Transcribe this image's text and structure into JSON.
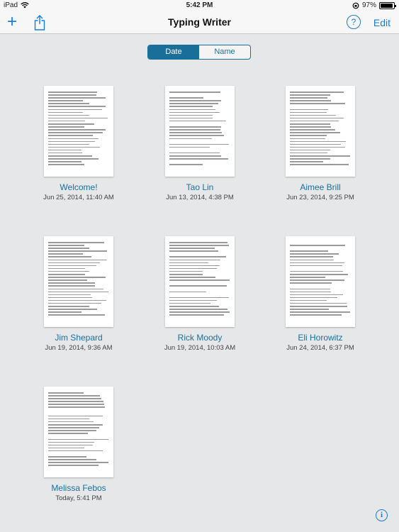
{
  "status_bar": {
    "device": "iPad",
    "time": "5:42 PM",
    "battery": "97%",
    "battery_level": 0.97
  },
  "nav": {
    "title": "Typing Writer",
    "add_icon": "+",
    "help_icon": "?",
    "edit_label": "Edit"
  },
  "sort": {
    "options": [
      "Date",
      "Name"
    ],
    "selected": "Date"
  },
  "documents": [
    {
      "title": "Welcome!",
      "date": "Jun 25, 2014, 11:40 AM"
    },
    {
      "title": "Tao Lin",
      "date": "Jun 13, 2014, 4:38 PM"
    },
    {
      "title": "Aimee Brill",
      "date": "Jun 23, 2014, 9:25 PM"
    },
    {
      "title": "Jim Shepard",
      "date": "Jun 19, 2014, 9:36 AM"
    },
    {
      "title": "Rick Moody",
      "date": "Jun 19, 2014, 10:03 AM"
    },
    {
      "title": "Eli Horowitz",
      "date": "Jun 24, 2014, 6:37 PM"
    },
    {
      "title": "Melissa Febos",
      "date": "Today, 5:41 PM"
    }
  ],
  "info_icon": "i",
  "colors": {
    "accent": "#1a7bd5",
    "segment": "#1a6f9a",
    "background": "#e6e7e8"
  }
}
